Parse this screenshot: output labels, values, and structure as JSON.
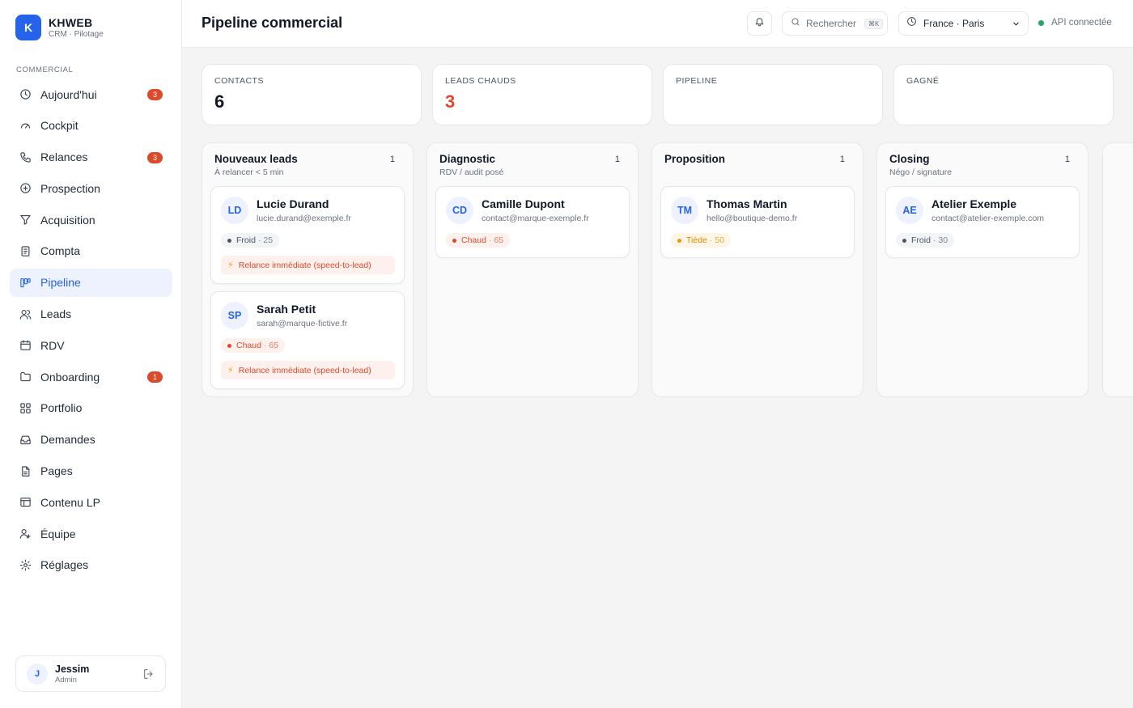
{
  "brand": {
    "logo_letter": "K",
    "name": "KHWEB",
    "subtitle": "CRM · Pilotage"
  },
  "sidebar": {
    "section": "COMMERCIAL",
    "items": [
      {
        "label": "Aujourd'hui",
        "icon": "clock-icon",
        "badge": "3"
      },
      {
        "label": "Cockpit",
        "icon": "gauge-icon"
      },
      {
        "label": "Relances",
        "icon": "phone-icon",
        "badge": "3"
      },
      {
        "label": "Prospection",
        "icon": "plus-circle-icon"
      },
      {
        "label": "Acquisition",
        "icon": "funnel-icon"
      },
      {
        "label": "Compta",
        "icon": "receipt-icon"
      },
      {
        "label": "Pipeline",
        "icon": "kanban-icon",
        "active": true
      },
      {
        "label": "Leads",
        "icon": "users-icon"
      },
      {
        "label": "RDV",
        "icon": "calendar-icon"
      },
      {
        "label": "Onboarding",
        "icon": "folder-icon",
        "badge": "1"
      },
      {
        "label": "Portfolio",
        "icon": "grid-icon"
      },
      {
        "label": "Demandes",
        "icon": "inbox-icon"
      },
      {
        "label": "Pages",
        "icon": "file-icon"
      },
      {
        "label": "Contenu LP",
        "icon": "layout-icon"
      },
      {
        "label": "Équipe",
        "icon": "team-icon"
      },
      {
        "label": "Réglages",
        "icon": "gear-icon"
      }
    ],
    "user": {
      "initial": "J",
      "name": "Jessim",
      "role": "Admin"
    }
  },
  "header": {
    "title": "Pipeline commercial",
    "search_placeholder": "Rechercher",
    "search_shortcut": "⌘K",
    "region": "France · Paris",
    "api_status": "API connectée"
  },
  "stats": [
    {
      "label": "CONTACTS",
      "value": "6"
    },
    {
      "label": "LEADS CHAUDS",
      "value": "3"
    },
    {
      "label": "PIPELINE",
      "value": ""
    },
    {
      "label": "GAGNÉ",
      "value": ""
    }
  ],
  "columns": [
    {
      "title": "Nouveaux leads",
      "count": "1",
      "subtitle": "À relancer < 5 min",
      "cards": [
        {
          "initials": "LD",
          "name": "Lucie Durand",
          "email": "lucie.durand@exemple.fr",
          "temp": "Froid",
          "score": "· 25",
          "relance": "Relance immédiate (speed-to-lead)"
        },
        {
          "initials": "SP",
          "name": "Sarah Petit",
          "email": "sarah@marque-fictive.fr",
          "temp": "Chaud",
          "score": "· 65",
          "relance": "Relance immédiate (speed-to-lead)"
        }
      ]
    },
    {
      "title": "Diagnostic",
      "count": "1",
      "subtitle": "RDV / audit posé",
      "cards": [
        {
          "initials": "CD",
          "name": "Camille Dupont",
          "email": "contact@marque-exemple.fr",
          "temp": "Chaud",
          "score": "· 65"
        }
      ]
    },
    {
      "title": "Proposition",
      "count": "1",
      "subtitle": "",
      "cards": [
        {
          "initials": "TM",
          "name": "Thomas Martin",
          "email": "hello@boutique-demo.fr",
          "temp": "Tiède",
          "score": "· 50"
        }
      ]
    },
    {
      "title": "Closing",
      "count": "1",
      "subtitle": "Négo / signature",
      "cards": [
        {
          "initials": "AE",
          "name": "Atelier Exemple",
          "email": "contact@atelier-exemple.com",
          "temp": "Froid",
          "score": "· 30"
        }
      ]
    }
  ],
  "colors": {
    "accent": "#2563eb",
    "hot": "#dc4a2c",
    "warm": "#e59a0d",
    "online": "#22a565"
  }
}
